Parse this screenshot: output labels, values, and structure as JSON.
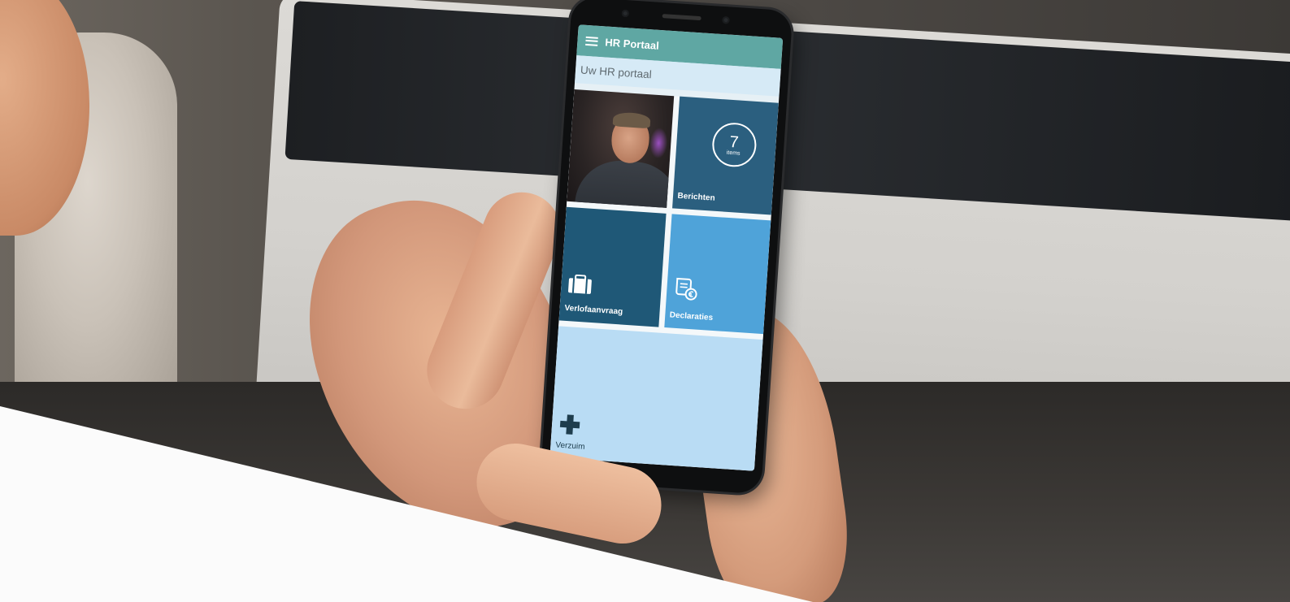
{
  "app": {
    "title": "HR Portaal",
    "subtitle": "Uw HR portaal"
  },
  "tiles": [
    {
      "id": "profile",
      "label": "",
      "type": "photo"
    },
    {
      "id": "berichten",
      "label": "Berichten",
      "count": "7",
      "count_unit": "items",
      "color": "#2b5f7f"
    },
    {
      "id": "verlof",
      "label": "Verlofaanvraag",
      "icon": "suitcase-icon",
      "color": "#1f5877"
    },
    {
      "id": "declaraties",
      "label": "Declaraties",
      "icon": "receipt-euro-icon",
      "color": "#4fa3d9"
    },
    {
      "id": "verzuim",
      "label": "Verzuim",
      "icon": "plus-icon",
      "color": "#b9dcf4"
    }
  ],
  "colors": {
    "header": "#5fa7a3",
    "subheader": "#d6eaf6"
  }
}
